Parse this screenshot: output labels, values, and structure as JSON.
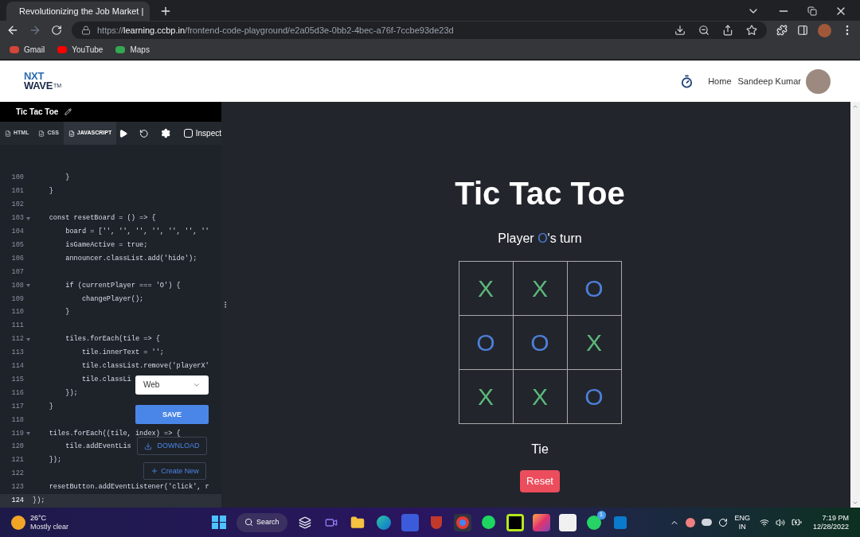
{
  "browser": {
    "tab_title": "Revolutionizing the Job Market |",
    "url_scheme": "https://",
    "url_host": "learning.ccbp.in",
    "url_path": "/frontend-code-playground/e2a05d3e-0bb2-4bec-a76f-7ccbe93de23d",
    "bookmarks": [
      "Gmail",
      "YouTube",
      "Maps"
    ]
  },
  "header": {
    "logo_top": "NXT",
    "logo_bottom": "WAVE",
    "logo_mark": "TM",
    "nav": [
      "Home"
    ],
    "user_name": "Sandeep Kumar"
  },
  "editor": {
    "title": "Tic Tac Toe",
    "tabs": [
      {
        "label": "HTML",
        "selected": false
      },
      {
        "label": "CSS",
        "selected": false
      },
      {
        "label": "JAVASCRIPT",
        "selected": true
      }
    ],
    "inspect": {
      "label": "Inspect",
      "checked": false
    },
    "lines": [
      {
        "number": "100",
        "text": "        }",
        "foldable": false,
        "active": false
      },
      {
        "number": "101",
        "text": "    }",
        "foldable": false,
        "active": false
      },
      {
        "number": "102",
        "foldable": false,
        "active": false
      },
      {
        "number": "103",
        "text": "    const resetBoard = () => {",
        "foldable": true,
        "active": false
      },
      {
        "number": "104",
        "text": "        board = ['', '', '', '', '', '', ''",
        "foldable": false,
        "active": false
      },
      {
        "number": "105",
        "text": "        isGameActive = true;",
        "foldable": false,
        "active": false
      },
      {
        "number": "106",
        "text": "        announcer.classList.add('hide');",
        "foldable": false,
        "active": false
      },
      {
        "number": "107",
        "foldable": false,
        "active": false
      },
      {
        "number": "108",
        "text": "        if (currentPlayer === 'O') {",
        "foldable": true,
        "active": false
      },
      {
        "number": "109",
        "text": "            changePlayer();",
        "foldable": false,
        "active": false
      },
      {
        "number": "110",
        "text": "        }",
        "foldable": false,
        "active": false
      },
      {
        "number": "111",
        "foldable": false,
        "active": false
      },
      {
        "number": "112",
        "text": "        tiles.forEach(tile => {",
        "foldable": true,
        "active": false
      },
      {
        "number": "113",
        "text": "            tile.innerText = '';",
        "foldable": false,
        "active": false
      },
      {
        "number": "114",
        "text": "            tile.classList.remove('playerX'",
        "foldable": false,
        "active": false
      },
      {
        "number": "115",
        "text": "            tile.classLi",
        "foldable": false,
        "active": false
      },
      {
        "number": "116",
        "text": "        });",
        "foldable": false,
        "active": false
      },
      {
        "number": "117",
        "text": "    }",
        "foldable": false,
        "active": false
      },
      {
        "number": "118",
        "foldable": false,
        "active": false
      },
      {
        "number": "119",
        "text": "    tiles.forEach((tile, index) => {",
        "foldable": true,
        "active": false
      },
      {
        "number": "120",
        "text": "        tile.addEventLis",
        "foldable": false,
        "active": false
      },
      {
        "number": "121",
        "text": "    });",
        "foldable": false,
        "active": false
      },
      {
        "number": "122",
        "foldable": false,
        "active": false
      },
      {
        "number": "123",
        "text": "    resetButton.addEventListener('click', r",
        "foldable": false,
        "active": false
      },
      {
        "number": "124",
        "text": "});",
        "foldable": false,
        "active": true
      }
    ],
    "env_select": "Web",
    "save": "SAVE",
    "download": "DOWNLOAD",
    "create_new": "Create New"
  },
  "game": {
    "title": "Tic Tac Toe",
    "turn_prefix": "Player ",
    "turn_player": "O",
    "turn_suffix": "'s turn",
    "board": [
      [
        "X",
        "X",
        "O"
      ],
      [
        "O",
        "O",
        "X"
      ],
      [
        "X",
        "X",
        "O"
      ]
    ],
    "result": "Tie",
    "reset": "Reset"
  },
  "taskbar": {
    "temperature": "26°C",
    "weather": "Mostly clear",
    "search": "Search",
    "chat_badge": "1",
    "language": [
      "ENG",
      "IN"
    ],
    "time": "7:19 PM",
    "date": "12/28/2022"
  }
}
